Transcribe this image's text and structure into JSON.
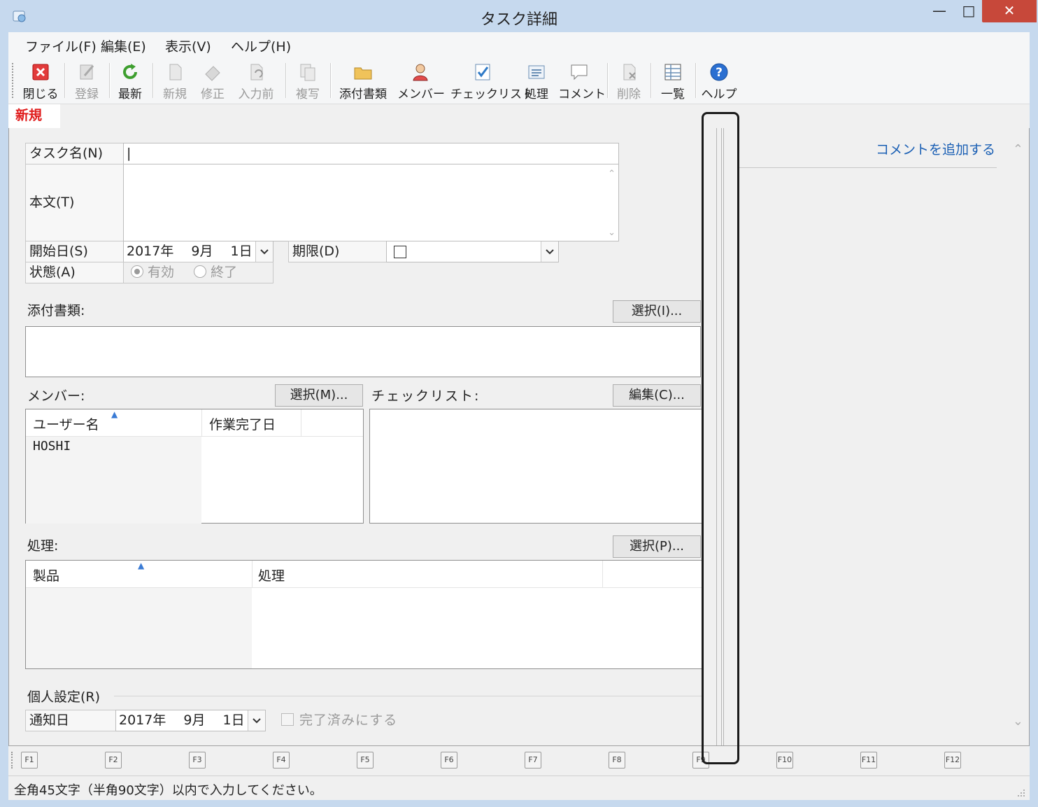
{
  "window": {
    "title": "タスク詳細"
  },
  "menu": [
    "ファイル(F)",
    "編集(E)",
    "表示(V)",
    "ヘルプ(H)"
  ],
  "toolbar": {
    "close": "閉じる",
    "register": "登録",
    "refresh": "最新",
    "new": "新規",
    "edit": "修正",
    "before_input": "入力前",
    "copy": "複写",
    "attachments": "添付書類",
    "members": "メンバー",
    "checklist": "チェックリスト",
    "process": "処理",
    "comment": "コメント",
    "delete": "削除",
    "list": "一覧",
    "help": "ヘルプ"
  },
  "tab": {
    "label": "新規"
  },
  "form": {
    "task_name_label": "タスク名(N)",
    "task_name_value": "|",
    "body_label": "本文(T)",
    "start_date_label": "開始日(S)",
    "start_date_value": "2017年　 9月　 1日",
    "deadline_label": "期限(D)",
    "status_label": "状態(A)",
    "status_active": "有効",
    "status_done": "終了"
  },
  "attachments": {
    "label": "添付書類:",
    "select_button": "選択(I)..."
  },
  "members": {
    "label": "メンバー:",
    "select_button": "選択(M)...",
    "col_user": "ユーザー名",
    "col_done": "作業完了日",
    "rows": [
      {
        "user": "HOSHI",
        "done": ""
      }
    ]
  },
  "checklist": {
    "label": "チェックリスト:",
    "edit_button": "編集(C)..."
  },
  "process": {
    "label": "処理:",
    "select_button": "選択(P)...",
    "col_product": "製品",
    "col_process": "処理"
  },
  "personal": {
    "label": "個人設定(R)",
    "notify_label": "通知日",
    "notify_value": "2017年　 9月　 1日",
    "mark_done": "完了済みにする"
  },
  "comment": {
    "add_link": "コメントを追加する"
  },
  "fkeys": [
    "F1",
    "F2",
    "F3",
    "F4",
    "F5",
    "F6",
    "F7",
    "F8",
    "F9",
    "F10",
    "F11",
    "F12"
  ],
  "status": {
    "message": "全角45文字（半角90文字）以内で入力してください。"
  },
  "colors": {
    "accent": "#1a5fb4",
    "tab_red": "#e01b1b",
    "close": "#c7483a"
  }
}
